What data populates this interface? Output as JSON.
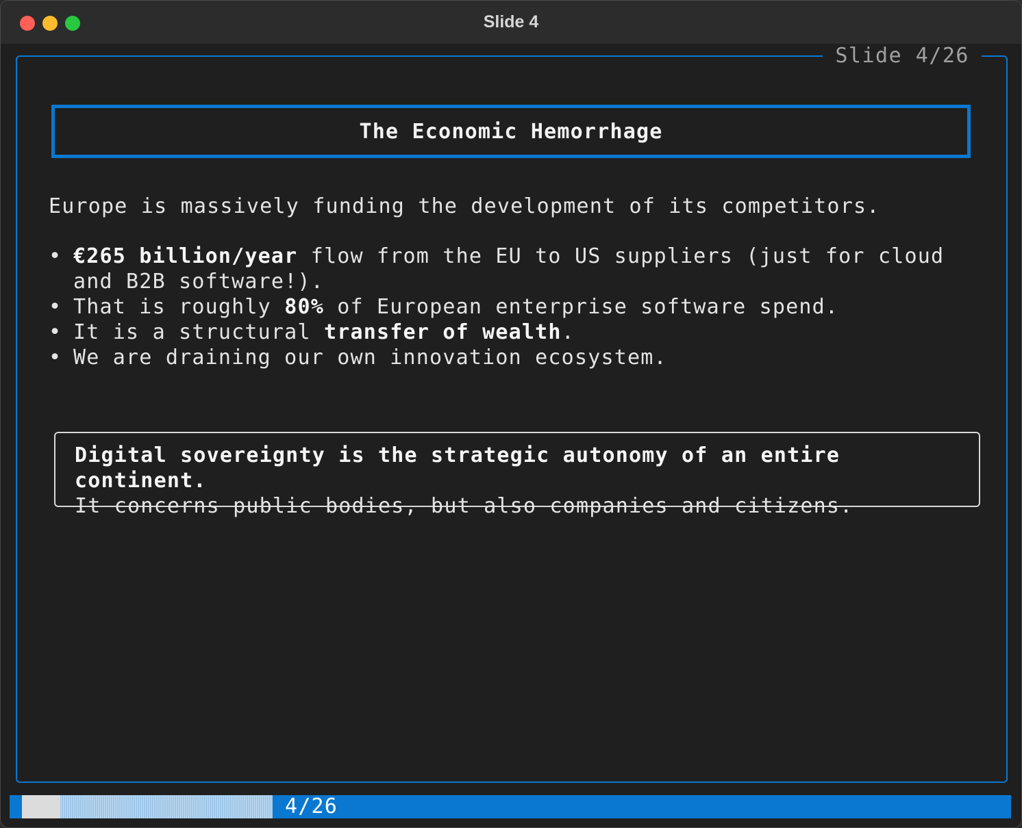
{
  "window": {
    "title": "Slide 4"
  },
  "slide": {
    "counter": "Slide 4/26",
    "title": "The Economic Hemorrhage",
    "intro": "Europe is massively funding the development of its competitors.",
    "bullet_symbol": "•",
    "bullets": [
      {
        "bold": "€265 billion/year",
        "rest": " flow from the EU to US suppliers (just for cloud and B2B software!)."
      },
      {
        "before": "That is roughly ",
        "bold": "80%",
        "after": " of European enterprise software spend."
      },
      {
        "before": "It is a structural ",
        "bold": "transfer of wealth",
        "after": "."
      },
      {
        "text": "We are draining our own innovation ecosystem."
      }
    ],
    "callout": {
      "line1": "Digital sovereignty is the strategic autonomy of an entire continent.",
      "line2": "It concerns public bodies, but also companies and citizens."
    }
  },
  "statusbar": {
    "position": "4/26",
    "progress_fraction": 0.154
  },
  "colors": {
    "accent": "#0a78d0",
    "background": "#1f1f1f",
    "text": "#e4e4e4"
  }
}
